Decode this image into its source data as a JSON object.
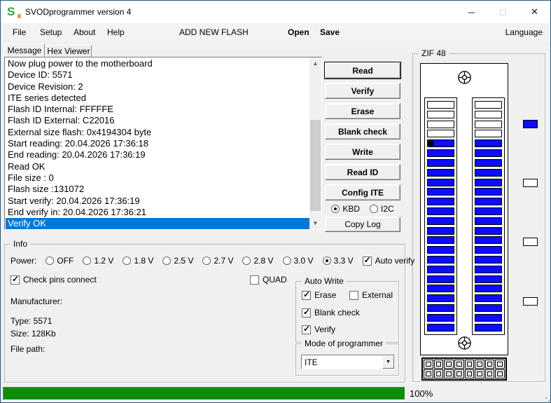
{
  "window": {
    "title": "SVODprogrammer version 4",
    "icon_letter": "S",
    "minimize_glyph": "─",
    "maximize_glyph": "◻",
    "close_glyph": "✕"
  },
  "menu": {
    "items": [
      "File",
      "Setup",
      "About",
      "Help"
    ],
    "add_new_flash": "ADD NEW FLASH",
    "open": "Open",
    "save": "Save",
    "language": "Language"
  },
  "tabs": {
    "message": "Message",
    "hex_viewer": "Hex Viewer"
  },
  "log": {
    "lines": [
      "Now plug power to the motherboard",
      "Device ID: 5571",
      "Device Revision: 2",
      "ITE series detected",
      "Flash ID Internal: FFFFFE",
      "Flash ID External: C22016",
      "External size flash: 0x4194304 byte",
      "Start reading: 20.04.2026 17:36:18",
      "End reading: 20.04.2026 17:36:19",
      "Read OK",
      "File size : 0",
      "Flash size :131072",
      "Start verify: 20.04.2026 17:36:19",
      "End verify in: 20.04.2026 17:36:21",
      "Verify OK"
    ],
    "selected_line": "Verify OK"
  },
  "actions": {
    "buttons": [
      "Read",
      "Verify",
      "Erase",
      "Blank check",
      "Write",
      "Read ID",
      "Config ITE"
    ],
    "default_button": "Read",
    "interface_radios": [
      {
        "label": "KBD",
        "selected": true
      },
      {
        "label": "I2C",
        "selected": false
      }
    ],
    "copy_log": "Copy Log"
  },
  "zif": {
    "label": "ZIF 48",
    "columns": 2,
    "slots_per_column": 24,
    "empty_slots_per_column": 4,
    "legend_colors": [
      "#0D0DFB",
      "#FFFFFF",
      "#FFFFFF",
      "#FFFFFF"
    ]
  },
  "info": {
    "label": "Info",
    "power_label": "Power:",
    "power_options": [
      {
        "label": "OFF",
        "selected": false
      },
      {
        "label": "1.2 V",
        "selected": false
      },
      {
        "label": "1.8 V",
        "selected": false
      },
      {
        "label": "2.5 V",
        "selected": false
      },
      {
        "label": "2.7 V",
        "selected": false
      },
      {
        "label": "2.8 V",
        "selected": false
      },
      {
        "label": "3.0 V",
        "selected": false
      },
      {
        "label": "3.3 V",
        "selected": true
      }
    ],
    "auto_verify": {
      "label": "Auto verify",
      "checked": true
    },
    "check_pins": {
      "label": "Check pins connect",
      "checked": true
    },
    "quad": {
      "label": "QUAD",
      "checked": false
    },
    "manufacturer_label": "Manufacturer:",
    "type_label": "Type: 5571",
    "size_label": "Size: 128Kb",
    "file_path_label": "File path:",
    "auto_write": {
      "label": "Auto Write",
      "erase": {
        "label": "Erase",
        "checked": true
      },
      "external": {
        "label": "External",
        "checked": false
      },
      "blank_check": {
        "label": "Blank check",
        "checked": true
      },
      "verify": {
        "label": "Verify",
        "checked": true
      }
    },
    "mode": {
      "label": "Mode of programmer",
      "value": "ITE"
    }
  },
  "progress": {
    "percent": 100,
    "label": "100%"
  },
  "colors": {
    "selection_blue": "#0078D7",
    "pin_blue": "#0D0DFB",
    "progress_green": "#0A8E0A",
    "window_border": "#27577D"
  }
}
